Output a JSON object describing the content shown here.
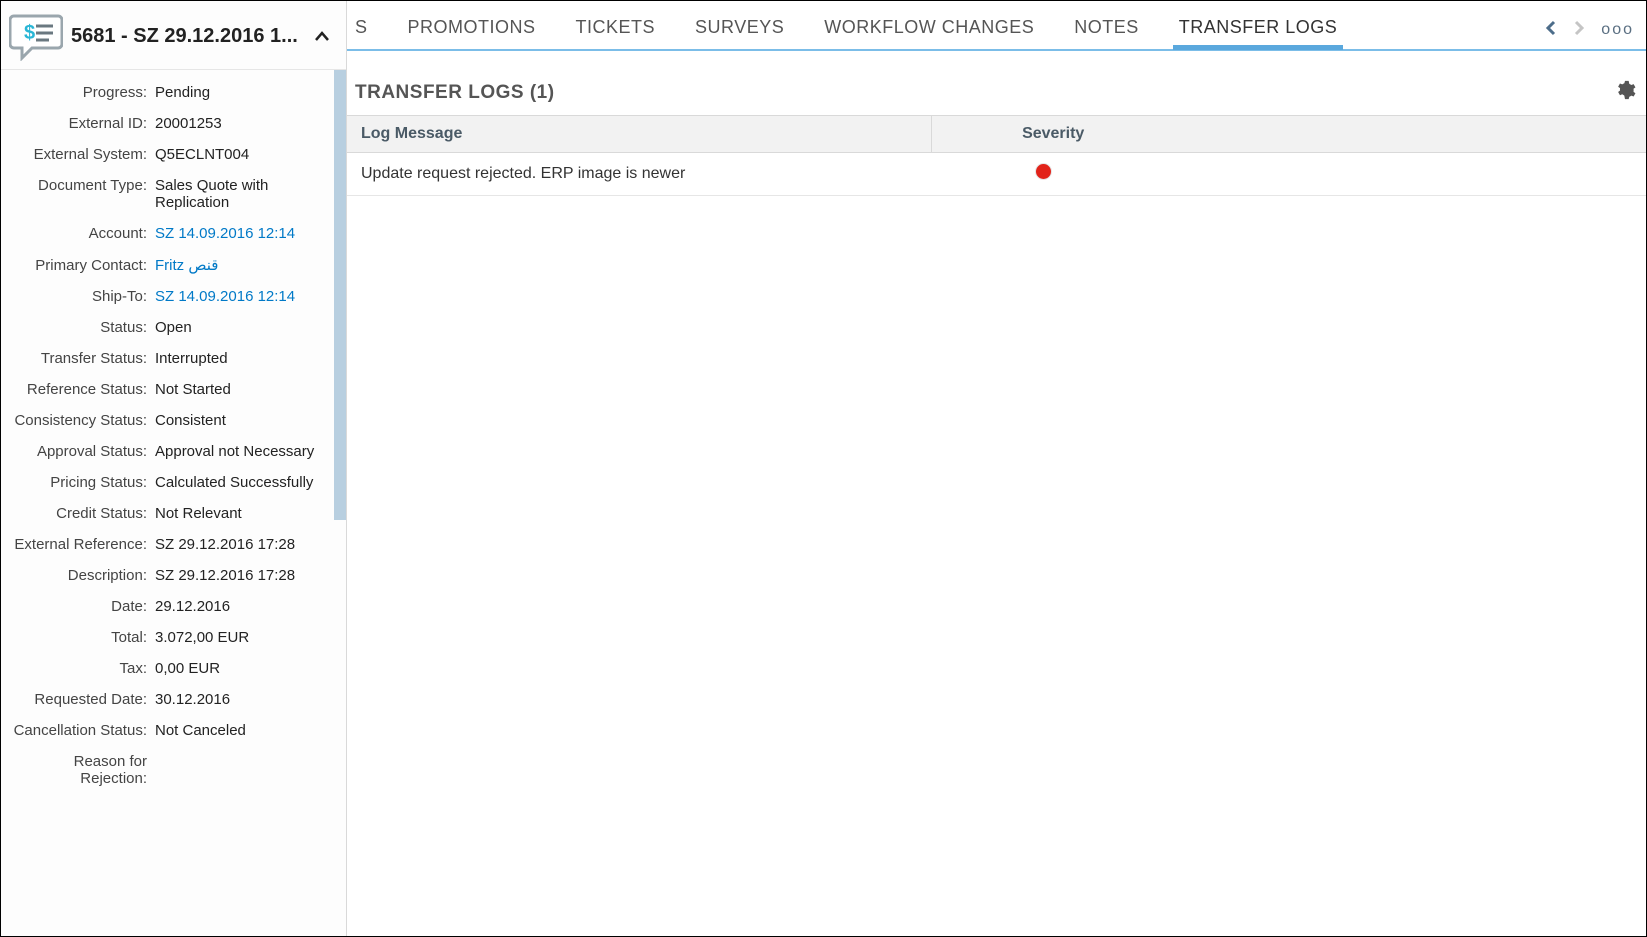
{
  "sidebar": {
    "title": "5681 - SZ 29.12.2016 1...",
    "fields": [
      {
        "label": "Progress:",
        "value": "Pending",
        "link": false
      },
      {
        "label": "External ID:",
        "value": "20001253",
        "link": false
      },
      {
        "label": "External System:",
        "value": "Q5ECLNT004",
        "link": false
      },
      {
        "label": "Document Type:",
        "value": "Sales Quote with Replication",
        "link": false
      },
      {
        "label": "Account:",
        "value": "SZ 14.09.2016 12:14",
        "link": true
      },
      {
        "label": "Primary Contact:",
        "value": "Fritz قنص",
        "link": true
      },
      {
        "label": "Ship-To:",
        "value": "SZ 14.09.2016 12:14",
        "link": true
      },
      {
        "label": "Status:",
        "value": "Open",
        "link": false
      },
      {
        "label": "Transfer Status:",
        "value": "Interrupted",
        "link": false
      },
      {
        "label": "Reference Status:",
        "value": "Not Started",
        "link": false
      },
      {
        "label": "Consistency Status:",
        "value": "Consistent",
        "link": false
      },
      {
        "label": "Approval Status:",
        "value": "Approval not Necessary",
        "link": false
      },
      {
        "label": "Pricing Status:",
        "value": "Calculated Successfully",
        "link": false
      },
      {
        "label": "Credit Status:",
        "value": "Not Relevant",
        "link": false
      },
      {
        "label": "External Reference:",
        "value": "SZ 29.12.2016 17:28",
        "link": false
      },
      {
        "label": "Description:",
        "value": "SZ 29.12.2016 17:28",
        "link": false
      },
      {
        "label": "Date:",
        "value": "29.12.2016",
        "link": false
      },
      {
        "label": "Total:",
        "value": "3.072,00 EUR",
        "link": false
      },
      {
        "label": "Tax:",
        "value": "0,00 EUR",
        "link": false
      },
      {
        "label": "Requested Date:",
        "value": "30.12.2016",
        "link": false
      },
      {
        "label": "Cancellation Status:",
        "value": "Not Canceled",
        "link": false
      },
      {
        "label": "Reason for Rejection:",
        "value": "",
        "link": false
      }
    ]
  },
  "tabs": {
    "partial": "S",
    "items": [
      "PROMOTIONS",
      "TICKETS",
      "SURVEYS",
      "WORKFLOW CHANGES",
      "NOTES",
      "TRANSFER LOGS"
    ],
    "active": "TRANSFER LOGS"
  },
  "section": {
    "title": "TRANSFER LOGS (1)"
  },
  "table": {
    "headers": {
      "log": "Log Message",
      "severity": "Severity"
    },
    "rows": [
      {
        "message": "Update request rejected. ERP image is newer",
        "severity": "error"
      }
    ]
  },
  "colors": {
    "link": "#0079c7",
    "accent": "#5aa8dd",
    "error": "#e2231a"
  }
}
